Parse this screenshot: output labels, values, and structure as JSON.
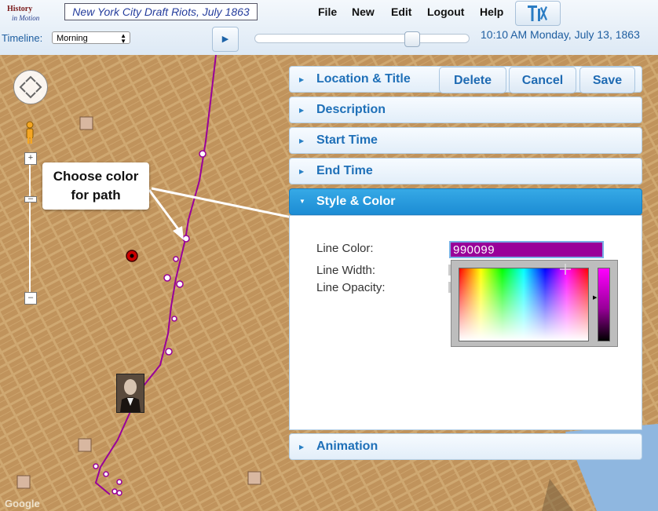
{
  "header": {
    "logo_line1": "History",
    "logo_line2": "in Motion",
    "project_title": "New York City Draft Riots, July 1863",
    "menu": [
      "File",
      "New",
      "Edit",
      "Logout",
      "Help"
    ],
    "datetime": "10:10 AM Monday, July 13, 1863"
  },
  "timeline": {
    "label": "Timeline:",
    "selected": "Morning",
    "play": "▶"
  },
  "panel": {
    "buttons": {
      "delete": "Delete",
      "cancel": "Cancel",
      "save": "Save"
    },
    "sections": [
      "Location & Title",
      "Description",
      "Start Time",
      "End Time",
      "Style & Color",
      "Animation"
    ],
    "open_section": "Style & Color",
    "fields": {
      "line_color_label": "Line Color:",
      "line_color_value": "990099",
      "line_width_label": "Line Width:",
      "line_opacity_label": "Line Opacity:"
    }
  },
  "callout": {
    "line1": "Choose color",
    "line2": "for path"
  },
  "map": {
    "google": "Google"
  },
  "colors": {
    "line_color": "#990099",
    "accent": "#1f70b8",
    "open_header": "#2a9ddc"
  },
  "icons": [
    "tools-icon",
    "pan-control-icon",
    "pegman-icon",
    "zoom-in-icon",
    "zoom-out-icon",
    "marker-icon",
    "portrait-icon"
  ]
}
